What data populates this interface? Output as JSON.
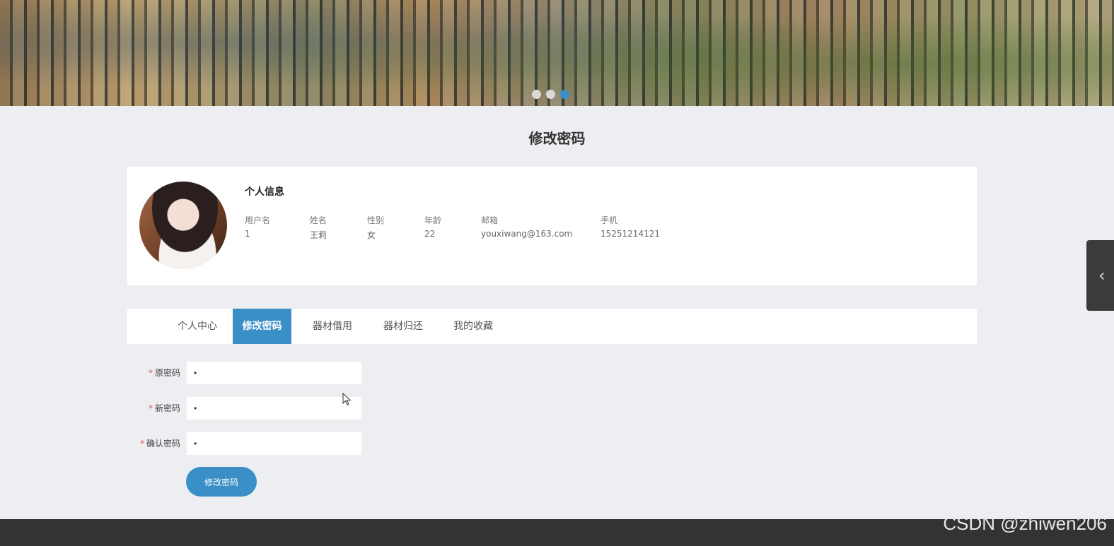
{
  "banner": {
    "slides": 3,
    "active_slide": 3
  },
  "page_title": "修改密码",
  "profile": {
    "heading": "个人信息",
    "fields": [
      {
        "label": "用户名",
        "value": "1"
      },
      {
        "label": "姓名",
        "value": "王莉"
      },
      {
        "label": "性别",
        "value": "女"
      },
      {
        "label": "年龄",
        "value": "22"
      },
      {
        "label": "邮箱",
        "value": "youxiwang@163.com"
      },
      {
        "label": "手机",
        "value": "15251214121"
      }
    ]
  },
  "tabs": [
    {
      "label": "个人中心",
      "active": false
    },
    {
      "label": "修改密码",
      "active": true
    },
    {
      "label": "器材借用",
      "active": false
    },
    {
      "label": "器材归还",
      "active": false
    },
    {
      "label": "我的收藏",
      "active": false
    }
  ],
  "form": {
    "required_mark": "*",
    "fields": [
      {
        "label": "原密码",
        "value": "•"
      },
      {
        "label": "新密码",
        "value": "•"
      },
      {
        "label": "确认密码",
        "value": "•"
      }
    ],
    "submit_label": "修改密码"
  },
  "side_handle_icon": "chevron-left-icon",
  "watermark": "CSDN @zhiwen206",
  "colors": {
    "accent": "#3a8fc6",
    "background": "#eceef1",
    "footer": "#333333",
    "required": "#e15555"
  }
}
